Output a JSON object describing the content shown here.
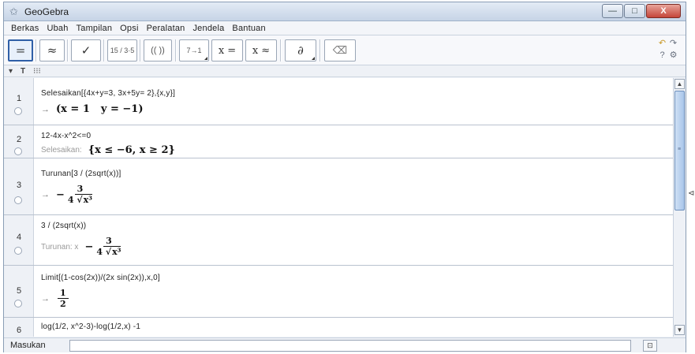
{
  "window": {
    "title": "GeoGebra",
    "buttons": {
      "minimize": "—",
      "maximize": "□",
      "close": "X"
    }
  },
  "menubar": {
    "items": [
      "Berkas",
      "Ubah",
      "Tampilan",
      "Opsi",
      "Peralatan",
      "Jendela",
      "Bantuan"
    ]
  },
  "toolbar": {
    "tools": [
      {
        "name": "evaluate",
        "symbol": "="
      },
      {
        "name": "numeric",
        "symbol": "≈"
      },
      {
        "name": "keep-input",
        "symbol": "✓"
      },
      {
        "name": "factor",
        "symbol": "15 / 3·5"
      },
      {
        "name": "expand",
        "symbol": "(( ))"
      },
      {
        "name": "substitute",
        "symbol": "7→1"
      },
      {
        "name": "solve",
        "symbol": "x ="
      },
      {
        "name": "solve-numeric",
        "symbol": "x ≈"
      },
      {
        "name": "derivative",
        "symbol": "∂"
      },
      {
        "name": "delete",
        "symbol": "⌫"
      }
    ]
  },
  "cas_header": {
    "left": "T",
    "right": "⁝⁝⁝"
  },
  "cas": {
    "rows": [
      {
        "num": "1",
        "input": "Selesaikan[{4x+y=3, 3x+5y= 2},{x,y}]",
        "output": {
          "prefix": "→",
          "x_expr": "x = 1",
          "y_expr": "y = −1"
        }
      },
      {
        "num": "2",
        "input": "12-4x-x^2<=0",
        "output": {
          "label": "Selesaikan:",
          "expr": "{x ≤ −6, x ≥ 2}"
        }
      },
      {
        "num": "3",
        "input": "Turunan[3 / (2sqrt(x))]",
        "output": {
          "prefix": "→",
          "sign": "−",
          "num": "3",
          "den_coef": "4",
          "den_rad": "x³"
        }
      },
      {
        "num": "4",
        "input": "3 / (2sqrt(x))",
        "output": {
          "label": "Turunan: x",
          "sign": "−",
          "num": "3",
          "den_coef": "4",
          "den_rad": "x³"
        }
      },
      {
        "num": "5",
        "input": "Limit[(1-cos(2x))/(2x sin(2x)),x,0]",
        "output": {
          "prefix": "→",
          "num": "1",
          "den": "2"
        }
      },
      {
        "num": "6",
        "input": "log(1/2, x^2-3)-log(1/2,x) -1"
      }
    ]
  },
  "input_bar": {
    "label": "Masukan",
    "value": ""
  },
  "side_mark": "⊲"
}
